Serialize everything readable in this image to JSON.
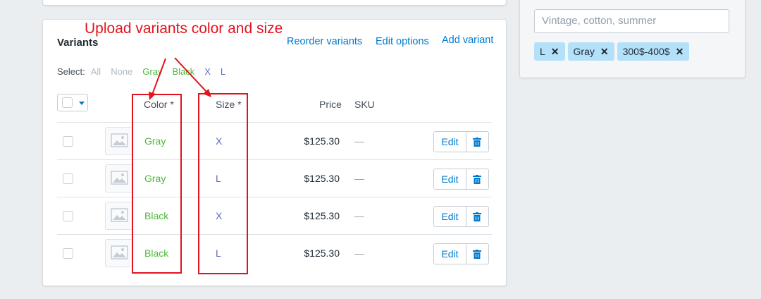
{
  "annotation": "Upload variants color and size",
  "sidebar": {
    "tag_input_placeholder": "Vintage, cotton, summer",
    "tags": [
      {
        "label": "L"
      },
      {
        "label": "Gray"
      },
      {
        "label": "300$-400$"
      }
    ]
  },
  "variants": {
    "title": "Variants",
    "links": {
      "reorder": "Reorder variants",
      "edit_options": "Edit options",
      "add": "Add variant"
    },
    "select": {
      "label": "Select:",
      "options": [
        "All",
        "None",
        "Gray",
        "Black",
        "X",
        "L"
      ]
    },
    "columns": {
      "color": "Color *",
      "size": "Size *",
      "price": "Price",
      "sku": "SKU"
    },
    "rows": [
      {
        "color": "Gray",
        "size": "X",
        "price": "$125.30",
        "sku": "—",
        "edit": "Edit"
      },
      {
        "color": "Gray",
        "size": "L",
        "price": "$125.30",
        "sku": "—",
        "edit": "Edit"
      },
      {
        "color": "Black",
        "size": "X",
        "price": "$125.30",
        "sku": "—",
        "edit": "Edit"
      },
      {
        "color": "Black",
        "size": "L",
        "price": "$125.30",
        "sku": "—",
        "edit": "Edit"
      }
    ]
  },
  "colors": {
    "link": "#007ace",
    "color_value": "#50b83c",
    "size_value": "#5c6ac4",
    "annotation": "#e0141e",
    "tag_bg": "#b4e1fa"
  }
}
